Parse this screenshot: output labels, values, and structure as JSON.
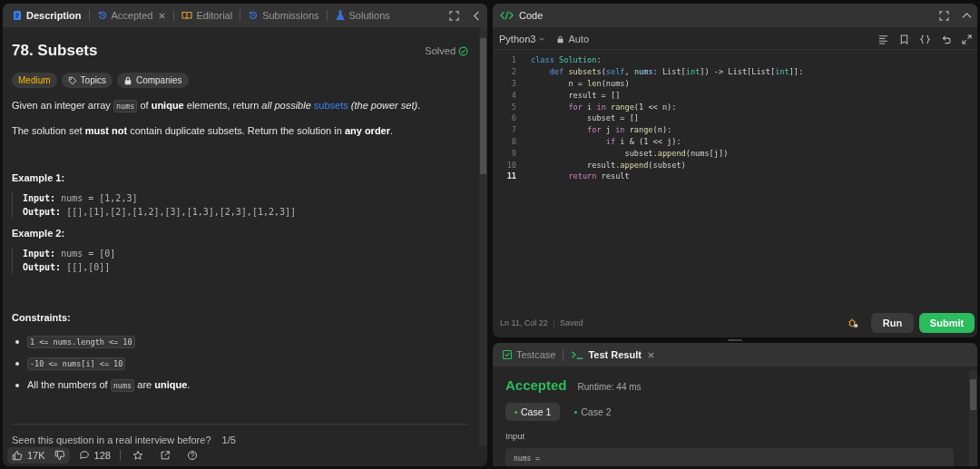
{
  "left_panel": {
    "tabs": [
      {
        "label": "Description",
        "selected": true,
        "closable": false
      },
      {
        "label": "Accepted",
        "selected": false,
        "closable": true
      },
      {
        "label": "Editorial",
        "selected": false,
        "closable": false
      },
      {
        "label": "Submissions",
        "selected": false,
        "closable": false
      },
      {
        "label": "Solutions",
        "selected": false,
        "closable": false
      }
    ],
    "title": "78. Subsets",
    "status": "Solved",
    "tags": [
      {
        "label": "Medium",
        "kind": "difficulty"
      },
      {
        "label": "Topics",
        "kind": "topics"
      },
      {
        "label": "Companies",
        "kind": "companies"
      }
    ],
    "paragraphs": [
      [
        {
          "kind": "text",
          "text": "Given an integer array "
        },
        {
          "kind": "code",
          "text": "nums"
        },
        {
          "kind": "text",
          "text": " of **unique** elements, return *all possible* "
        },
        {
          "kind": "link",
          "text": "subsets"
        },
        {
          "kind": "text",
          "text": " *(the power set)*."
        }
      ],
      [
        {
          "kind": "text",
          "text": "The solution set **must not** contain duplicate subsets. Return the solution in **any order**."
        }
      ]
    ],
    "examples": [
      {
        "title": "Example 1:",
        "input_label": "Input:",
        "input": "nums = [1,2,3]",
        "output_label": "Output:",
        "output": "[[],[1],[2],[1,2],[3],[1,3],[2,3],[1,2,3]]"
      },
      {
        "title": "Example 2:",
        "input_label": "Input:",
        "input": "nums = [0]",
        "output_label": "Output:",
        "output": "[[],[0]]"
      }
    ],
    "constraints_title": "Constraints:",
    "constraints": [
      [
        {
          "kind": "code",
          "text": "1 <= nums.length <= 10"
        }
      ],
      [
        {
          "kind": "code",
          "text": "-10 <= nums[i] <= 10"
        }
      ],
      [
        {
          "kind": "text",
          "text": "All the numbers of "
        },
        {
          "kind": "code",
          "text": "nums"
        },
        {
          "kind": "text",
          "text": " are **unique**."
        }
      ]
    ],
    "interview_question": "Seen this question in a real interview before?",
    "interview_page": "1/5",
    "likes": "17K",
    "comments": "128"
  },
  "code_panel": {
    "title": "Code",
    "language": "Python3",
    "mode": "Auto",
    "lines": [
      {
        "number": "1",
        "current": false,
        "tokens": [
          {
            "kind": "kw",
            "text": "class "
          },
          {
            "kind": "type",
            "text": "Solution"
          },
          {
            "kind": "plain",
            "text": ":"
          }
        ]
      },
      {
        "number": "2",
        "current": false,
        "tokens": [
          {
            "kind": "kw",
            "text": "    def "
          },
          {
            "kind": "fn",
            "text": "subsets"
          },
          {
            "kind": "plain",
            "text": "("
          },
          {
            "kind": "kw",
            "text": "self"
          },
          {
            "kind": "plain",
            "text": ", "
          },
          {
            "kind": "var",
            "text": "nums"
          },
          {
            "kind": "plain",
            "text": ": List["
          },
          {
            "kind": "type",
            "text": "int"
          },
          {
            "kind": "plain",
            "text": "]) -> List[List["
          },
          {
            "kind": "type",
            "text": "int"
          },
          {
            "kind": "plain",
            "text": "]]:"
          }
        ]
      },
      {
        "number": "3",
        "current": false,
        "tokens": [
          {
            "kind": "plain",
            "text": "        n = "
          },
          {
            "kind": "fn",
            "text": "len"
          },
          {
            "kind": "plain",
            "text": "(nums)"
          }
        ]
      },
      {
        "number": "4",
        "current": false,
        "tokens": [
          {
            "kind": "plain",
            "text": "        result = []"
          }
        ]
      },
      {
        "number": "5",
        "current": false,
        "tokens": [
          {
            "kind": "ctrl",
            "text": "        for"
          },
          {
            "kind": "plain",
            "text": " i "
          },
          {
            "kind": "ctrl",
            "text": "in "
          },
          {
            "kind": "fn",
            "text": "range"
          },
          {
            "kind": "plain",
            "text": "(1 << n):"
          }
        ]
      },
      {
        "number": "6",
        "current": false,
        "tokens": [
          {
            "kind": "plain",
            "text": "            subset = []"
          }
        ]
      },
      {
        "number": "7",
        "current": false,
        "tokens": [
          {
            "kind": "ctrl",
            "text": "            for"
          },
          {
            "kind": "plain",
            "text": " j "
          },
          {
            "kind": "ctrl",
            "text": "in "
          },
          {
            "kind": "fn",
            "text": "range"
          },
          {
            "kind": "plain",
            "text": "(n):"
          }
        ]
      },
      {
        "number": "8",
        "current": false,
        "tokens": [
          {
            "kind": "ctrl",
            "text": "                if"
          },
          {
            "kind": "plain",
            "text": " i & (1 << j):"
          }
        ]
      },
      {
        "number": "9",
        "current": false,
        "tokens": [
          {
            "kind": "plain",
            "text": "                    subset."
          },
          {
            "kind": "fn",
            "text": "append"
          },
          {
            "kind": "plain",
            "text": "(nums[j])"
          }
        ]
      },
      {
        "number": "10",
        "current": false,
        "tokens": [
          {
            "kind": "plain",
            "text": "            result."
          },
          {
            "kind": "fn",
            "text": "append"
          },
          {
            "kind": "plain",
            "text": "(subset)"
          }
        ]
      },
      {
        "number": "11",
        "current": true,
        "tokens": [
          {
            "kind": "ctrl",
            "text": "        return"
          },
          {
            "kind": "plain",
            "text": " result"
          }
        ]
      }
    ],
    "cursor": "Ln 11, Col 22",
    "save_state": "Saved",
    "run_label": "Run",
    "submit_label": "Submit"
  },
  "result_panel": {
    "tabs": [
      {
        "label": "Testcase",
        "selected": false,
        "closable": false
      },
      {
        "label": "Test Result",
        "selected": true,
        "closable": true
      }
    ],
    "verdict": "Accepted",
    "runtime": "Runtime: 44 ms",
    "cases": [
      {
        "label": "Case 1",
        "selected": true
      },
      {
        "label": "Case 2",
        "selected": false
      }
    ],
    "input_label": "Input",
    "input_value": "nums ="
  }
}
